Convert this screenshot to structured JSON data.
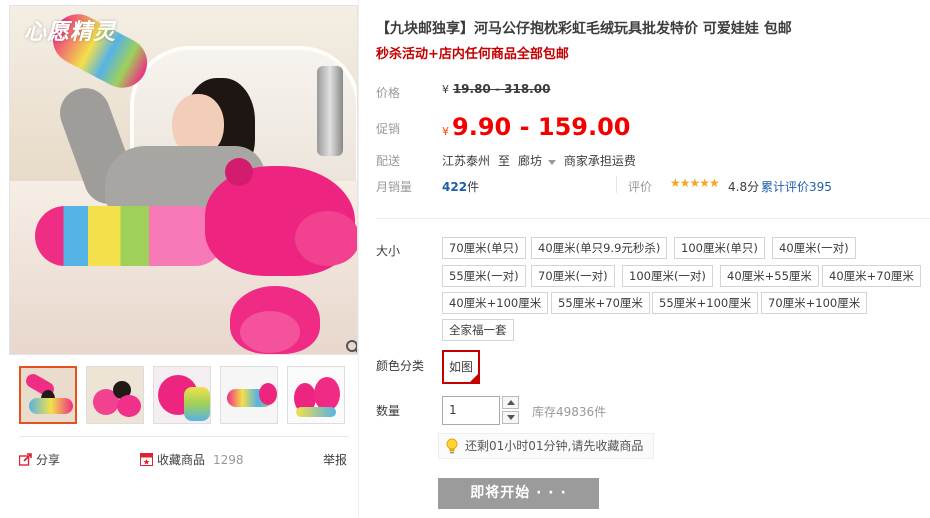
{
  "gallery": {
    "logo_text": "心愿精灵",
    "actions": {
      "share_label": "分享",
      "favorite_label": "收藏商品",
      "favorite_count": "1298",
      "report_label": "举报"
    }
  },
  "product": {
    "title": "【九块邮独享】河马公仔抱枕彩虹毛绒玩具批发特价 可爱娃娃 包邮",
    "subtitle": "秒杀活动+店内任何商品全部包邮"
  },
  "price": {
    "label": "价格",
    "currency": "¥",
    "original": "19.80 - 318.00",
    "promo_label": "促销",
    "promo": "9.90 - 159.00"
  },
  "shipping": {
    "label": "配送",
    "from": "江苏泰州",
    "to_word": "至",
    "destination": "廊坊",
    "fee": "商家承担运费"
  },
  "sales": {
    "label": "月销量",
    "count": "422",
    "unit": "件",
    "rating_label": "评价",
    "rating_value": "4.8分",
    "rating_stars": 4.8,
    "review_link": "累计评价395"
  },
  "size": {
    "label": "大小",
    "options": [
      "70厘米(单只)",
      "40厘米(单只9.9元秒杀)",
      "100厘米(单只)",
      "40厘米(一对)",
      "55厘米(一对)",
      "70厘米(一对)",
      "100厘米(一对)",
      "40厘米+55厘米",
      "40厘米+70厘米",
      "40厘米+100厘米",
      "55厘米+70厘米",
      "55厘米+100厘米",
      "70厘米+100厘米",
      "全家福一套"
    ]
  },
  "color": {
    "label": "颜色分类",
    "selected": "如图"
  },
  "quantity": {
    "label": "数量",
    "value": "1",
    "stock": "库存49836件"
  },
  "tip": "还剩01小时01分钟,请先收藏商品",
  "start_button": "即将开始 · · ·",
  "colors": {
    "price_red": "#f40000",
    "link_blue": "#1f5ea8",
    "selected_border": "#c40000",
    "button_gray": "#9b9b9b"
  }
}
